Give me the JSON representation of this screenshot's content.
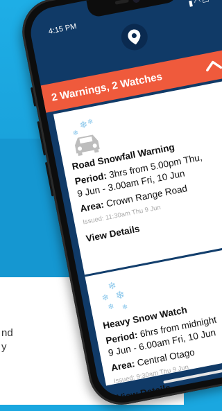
{
  "background": {
    "line1": "nd",
    "line2": "y"
  },
  "status_bar": {
    "time": "4:15 PM",
    "signal_icon": "signal-icon",
    "wifi_icon": "wifi-icon",
    "battery_icon": "battery-icon"
  },
  "header": {
    "title": "2 Warnings, 2 Watches",
    "accent_color": "#ef5a3c",
    "collapse_icon": "chevron-up-icon"
  },
  "location_icon": "location-pin-icon",
  "cards": [
    {
      "icon": "car-snow-icon",
      "title": "Road Snowfall Warning",
      "period_label": "Period:",
      "period_line1": "3hrs from 5.00pm Thu,",
      "period_line2": "9 Jun - 3.00am Fri, 10 Jun",
      "area_label": "Area:",
      "area": "Crown Range Road",
      "issued": "Issued: 11:30am Thu 9 Jun",
      "action": "View Details"
    },
    {
      "icon": "snowflakes-icon",
      "title": "Heavy Snow Watch",
      "period_label": "Period:",
      "period_line1": "6hrs from midnight",
      "period_line2": "9 Jun - 6.00am Fri, 10 Jun",
      "area_label": "Area:",
      "area": "Central Otago",
      "issued": "Issued: 9:30am Thu 9 Jun",
      "action": "View Details"
    }
  ]
}
